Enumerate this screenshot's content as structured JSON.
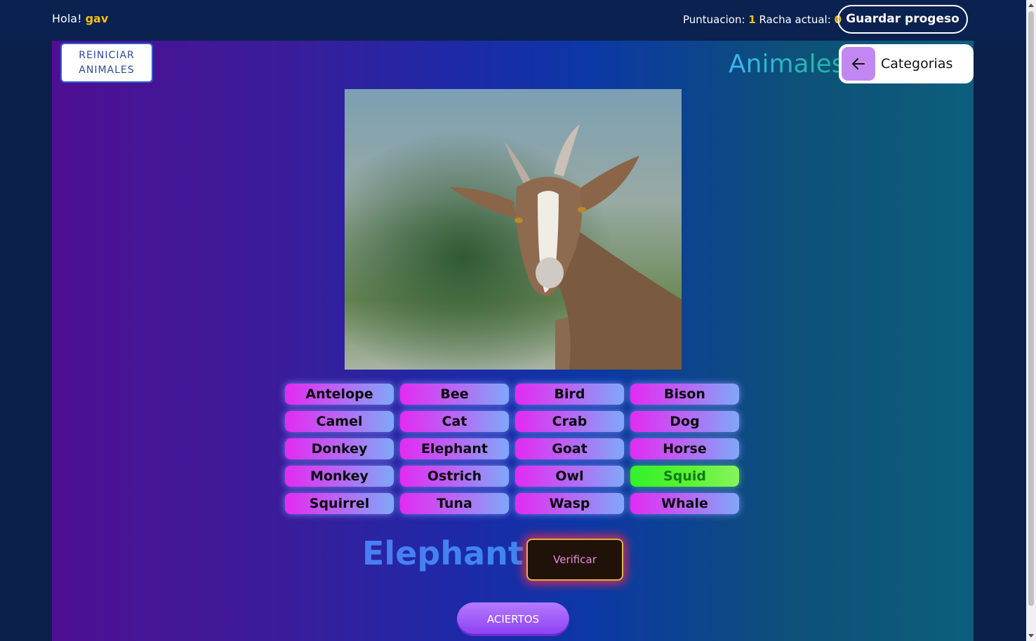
{
  "header": {
    "greeting": "Hola!",
    "username": "gav",
    "score_label": "Puntuacion:",
    "score_value": "1",
    "streak_label": "Racha actual:",
    "streak_value": "0",
    "save_label": "Guardar progeso"
  },
  "game": {
    "reset_label_line1": "REINICIAR",
    "reset_label_line2": "ANIMALES",
    "category_title": "Animales",
    "categories_label": "Categorias",
    "options": [
      "Antelope",
      "Bee",
      "Bird",
      "Bison",
      "Camel",
      "Cat",
      "Crab",
      "Dog",
      "Donkey",
      "Elephant",
      "Goat",
      "Horse",
      "Monkey",
      "Ostrich",
      "Owl",
      "Squid",
      "Squirrel",
      "Tuna",
      "Wasp",
      "Whale"
    ],
    "highlighted_option": "Squid",
    "current_word": "Elephant",
    "verify_label": "Verificar",
    "hits_label": "ACIERTOS"
  },
  "colors": {
    "accent_yellow": "#f6c20b",
    "option_gradient_start": "#e22bf2",
    "option_gradient_end": "#7fa8f8",
    "correct_green": "#33f22b",
    "verify_glow": "#ff2846"
  },
  "icons": {
    "back": "arrow-left-icon"
  }
}
